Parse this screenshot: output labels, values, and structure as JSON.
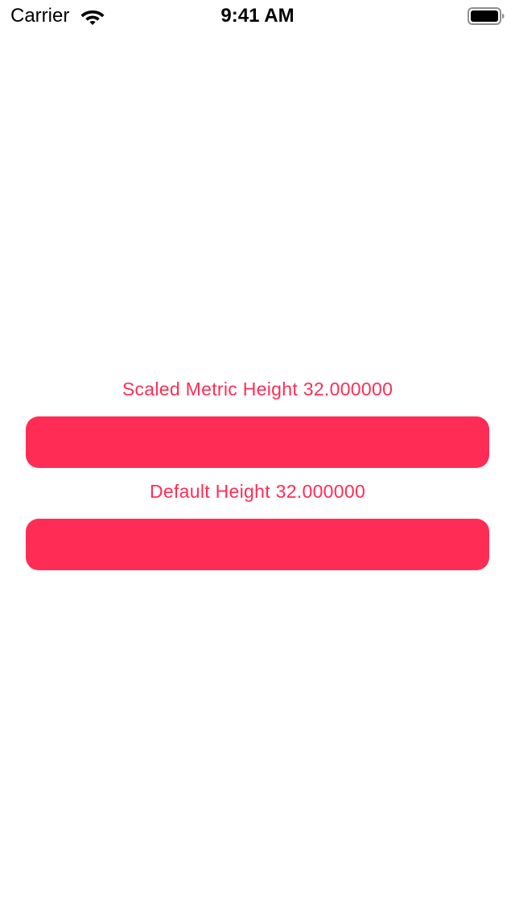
{
  "status_bar": {
    "carrier": "Carrier",
    "time": "9:41 AM",
    "wifi_icon": "wifi-icon",
    "battery_icon": "battery-icon"
  },
  "content": {
    "scaled_label": "Scaled Metric Height 32.000000",
    "default_label": "Default Height 32.000000"
  },
  "colors": {
    "accent": "#FF2D55",
    "background": "#FFFFFF",
    "status_text": "#000000"
  }
}
